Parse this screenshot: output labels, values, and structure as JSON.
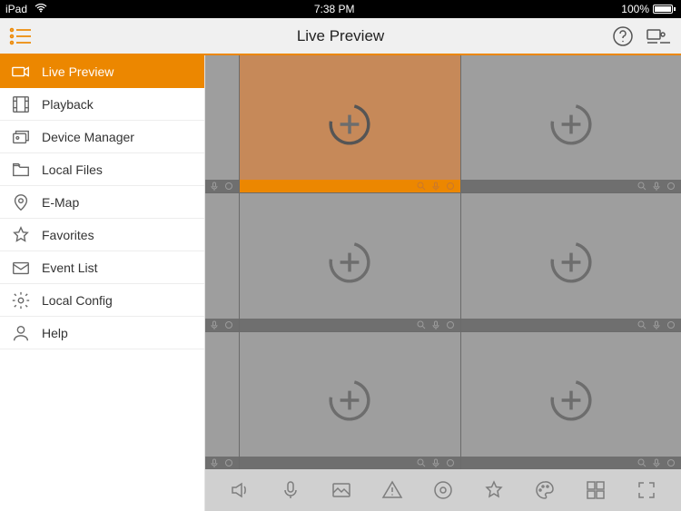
{
  "status": {
    "device": "iPad",
    "time": "7:38 PM",
    "battery": "100%"
  },
  "header": {
    "title": "Live Preview"
  },
  "sidebar": {
    "items": [
      {
        "label": "Live Preview",
        "icon": "camera",
        "active": true
      },
      {
        "label": "Playback",
        "icon": "film",
        "active": false
      },
      {
        "label": "Device Manager",
        "icon": "cards",
        "active": false
      },
      {
        "label": "Local Files",
        "icon": "folder",
        "active": false
      },
      {
        "label": "E-Map",
        "icon": "pin",
        "active": false
      },
      {
        "label": "Favorites",
        "icon": "star",
        "active": false
      },
      {
        "label": "Event List",
        "icon": "mail",
        "active": false
      },
      {
        "label": "Local Config",
        "icon": "gear",
        "active": false
      },
      {
        "label": "Help",
        "icon": "person",
        "active": false
      }
    ]
  },
  "grid": {
    "selected_index": 0,
    "layout": "3x3_partial_left_column"
  },
  "toolbar": {
    "items": [
      "speaker",
      "mic",
      "snapshot",
      "alert",
      "record",
      "favorite",
      "palette",
      "layout",
      "fullscreen"
    ]
  }
}
